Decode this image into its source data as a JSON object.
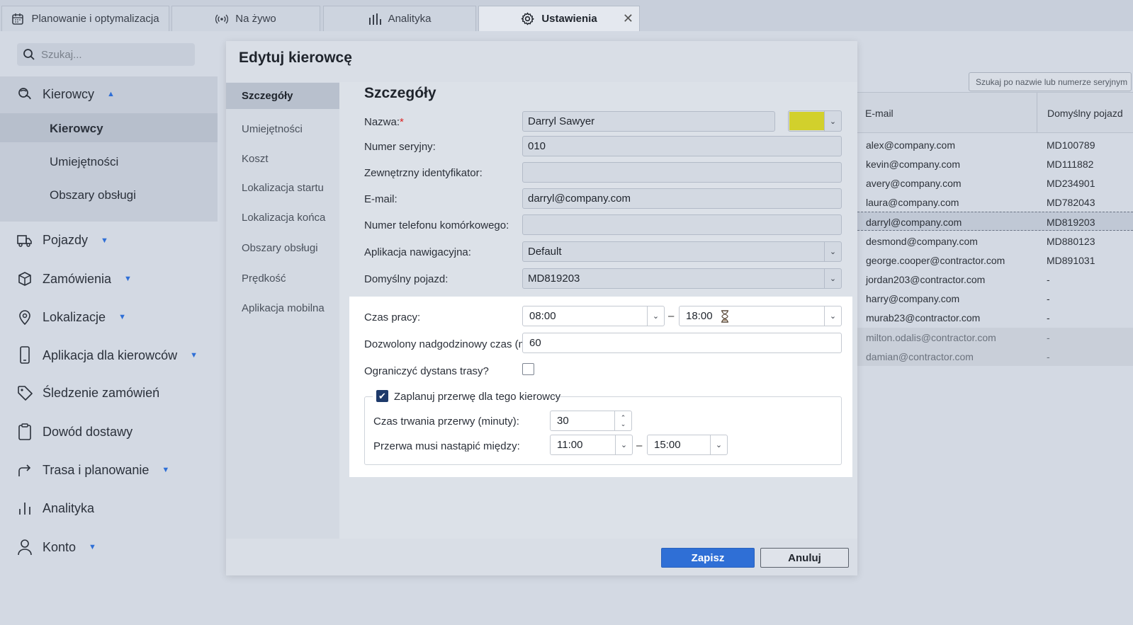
{
  "tabs": [
    {
      "label": "Planowanie i optymalizacja",
      "icon": "calendar-icon"
    },
    {
      "label": "Na żywo",
      "icon": "broadcast-icon"
    },
    {
      "label": "Analityka",
      "icon": "bar-chart-icon"
    },
    {
      "label": "Ustawienia",
      "icon": "gear-icon"
    }
  ],
  "sidebar": {
    "search_placeholder": "Szukaj...",
    "drivers_group": {
      "label": "Kierowcy",
      "sub": [
        "Kierowcy",
        "Umiejętności",
        "Obszary obsługi"
      ]
    },
    "items": [
      {
        "label": "Pojazdy",
        "icon": "truck-icon"
      },
      {
        "label": "Zamówienia",
        "icon": "box-icon"
      },
      {
        "label": "Lokalizacje",
        "icon": "location-pin-icon"
      },
      {
        "label": "Aplikacja dla kierowców",
        "icon": "phone-icon"
      },
      {
        "label": "Śledzenie zamówień",
        "icon": "tag-icon"
      },
      {
        "label": "Dowód dostawy",
        "icon": "clipboard-icon"
      },
      {
        "label": "Trasa i planowanie",
        "icon": "route-arrow-icon"
      },
      {
        "label": "Analityka",
        "icon": "analytics-icon"
      },
      {
        "label": "Konto",
        "icon": "user-icon"
      }
    ]
  },
  "table": {
    "search_placeholder": "Szukaj po nazwie lub numerze seryjnym",
    "headers": [
      "E-mail",
      "Domyślny pojazd"
    ],
    "rows": [
      {
        "email": "alex@company.com",
        "vehicle": "MD100789"
      },
      {
        "email": "kevin@company.com",
        "vehicle": "MD111882"
      },
      {
        "email": "avery@company.com",
        "vehicle": "MD234901"
      },
      {
        "email": "laura@company.com",
        "vehicle": "MD782043"
      },
      {
        "email": "darryl@company.com",
        "vehicle": "MD819203"
      },
      {
        "email": "desmond@company.com",
        "vehicle": "MD880123"
      },
      {
        "email": "george.cooper@contractor.com",
        "vehicle": "MD891031"
      },
      {
        "email": "jordan203@contractor.com",
        "vehicle": "-"
      },
      {
        "email": "harry@company.com",
        "vehicle": "-"
      },
      {
        "email": "murab23@contractor.com",
        "vehicle": "-"
      },
      {
        "email": "milton.odalis@contractor.com",
        "vehicle": "-"
      },
      {
        "email": "damian@contractor.com",
        "vehicle": "-"
      }
    ]
  },
  "dialog": {
    "title": "Edytuj kierowcę",
    "nav": [
      "Szczegóły",
      "Umiejętności",
      "Koszt",
      "Lokalizacja startu",
      "Lokalizacja końca",
      "Obszary obsługi",
      "Prędkość",
      "Aplikacja mobilna"
    ],
    "section_title": "Szczegóły",
    "fields": {
      "name_label": "Nazwa:",
      "name_required": "*",
      "name_value": "Darryl Sawyer",
      "color_value": "#d2d02c",
      "serial_label": "Numer seryjny:",
      "serial_value": "010",
      "external_id_label": "Zewnętrzny identyfikator:",
      "external_id_value": "",
      "email_label": "E-mail:",
      "email_value": "darryl@company.com",
      "phone_label": "Numer telefonu komórkowego:",
      "phone_value": "",
      "nav_app_label": "Aplikacja nawigacyjna:",
      "nav_app_value": "Default",
      "vehicle_label": "Domyślny pojazd:",
      "vehicle_value": "MD819203",
      "work_time_label": "Czas pracy:",
      "work_start": "08:00",
      "work_end": "18:00",
      "time_separator": "–",
      "overtime_label": "Dozwolony nadgodzinowy czas (min):",
      "overtime_value": "60",
      "limit_distance_label": "Ograniczyć dystans trasy?",
      "limit_distance_checked": false,
      "break_label": "Zaplanuj przerwę dla tego kierowcy",
      "break_checked": true,
      "break_duration_label": "Czas trwania przerwy (minuty):",
      "break_duration_value": "30",
      "break_window_label": "Przerwa musi nastąpić między:",
      "break_start": "11:00",
      "break_end": "15:00"
    },
    "save_label": "Zapisz",
    "cancel_label": "Anuluj"
  }
}
